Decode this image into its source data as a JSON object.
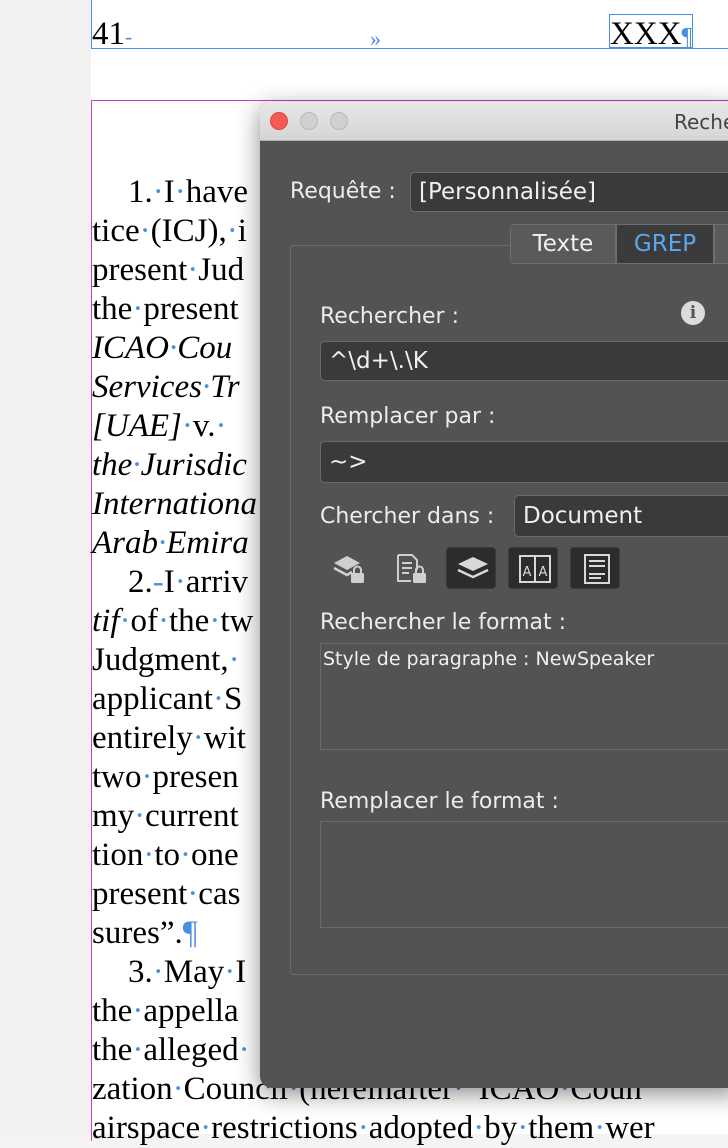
{
  "document": {
    "page_number": "41",
    "header_right": "XXX",
    "lines": [
      {
        "indent": true,
        "html": "1.<span class=\"inv\">·</span>I<span class=\"inv\">·</span>have"
      },
      {
        "indent": false,
        "html": "tice<span class=\"inv\">·</span>(ICJ),<span class=\"inv\">·</span>i"
      },
      {
        "indent": false,
        "html": "present<span class=\"inv\">·</span>Jud"
      },
      {
        "indent": false,
        "html": "the<span class=\"inv\">·</span>present"
      },
      {
        "indent": false,
        "html": "<i>ICAO<span class=\"inv\">·</span>Cou</i>"
      },
      {
        "indent": false,
        "html": "<i>Services<span class=\"inv\">·</span>Tr</i>"
      },
      {
        "indent": false,
        "html": "<i>[UAE]</i><span class=\"inv\">·</span>v.<span class=\"inv\">·</span>"
      },
      {
        "indent": false,
        "html": "<i>the<span class=\"inv\">·</span>Jurisdic</i>"
      },
      {
        "indent": false,
        "html": "<i>Internationa</i>"
      },
      {
        "indent": false,
        "html": "<i>Arab<span class=\"inv\">·</span>Emira</i>"
      },
      {
        "indent": true,
        "html": "2.<span class=\"inv\">‑</span>I<span class=\"inv\">·</span>arriv"
      },
      {
        "indent": false,
        "html": "<i>tif</i><span class=\"inv\">·</span>of<span class=\"inv\">·</span>the<span class=\"inv\">·</span>tw"
      },
      {
        "indent": false,
        "html": "Judgment,<span class=\"inv\">·</span>"
      },
      {
        "indent": false,
        "html": "applicant<span class=\"inv\">·</span>S"
      },
      {
        "indent": false,
        "html": "entirely<span class=\"inv\">·</span>wit"
      },
      {
        "indent": false,
        "html": "two<span class=\"inv\">·</span>presen"
      },
      {
        "indent": false,
        "html": "my<span class=\"inv\">·</span>current"
      },
      {
        "indent": false,
        "html": "tion<span class=\"inv\">·</span>to<span class=\"inv\">·</span>one"
      },
      {
        "indent": false,
        "html": "present<span class=\"inv\">·</span>cas"
      },
      {
        "indent": false,
        "html": "sures”.<span class=\"inv\">¶</span>"
      },
      {
        "indent": true,
        "html": "3.<span class=\"inv\">·</span>May<span class=\"inv\">·</span>I"
      },
      {
        "indent": false,
        "html": "the<span class=\"inv\">·</span>appella"
      },
      {
        "indent": false,
        "html": "the<span class=\"inv\">·</span>alleged<span class=\"inv\">·</span>"
      },
      {
        "indent": false,
        "html": "zation<span class=\"inv\">·</span>Council<span class=\"inv\">·</span>(hereinafter<span class=\"inv\">·</span>“ICAO<span class=\"inv\">·</span>Coun"
      },
      {
        "indent": false,
        "html": "airspace<span class=\"inv\">·</span>restrictions<span class=\"inv\">·</span>adopted<span class=\"inv\">·</span>by<span class=\"inv\">·</span>them<span class=\"inv\">·</span>wer"
      }
    ]
  },
  "dialog": {
    "title": "Reche",
    "query_label": "Requête :",
    "query_value": "[Personnalisée]",
    "tabs": [
      "Texte",
      "GREP",
      ""
    ],
    "active_tab": "GREP",
    "find_label": "Rechercher :",
    "find_value": "^\\d+\\.\\K",
    "replace_label": "Remplacer par :",
    "replace_value": "~>",
    "search_in_label": "Chercher dans :",
    "search_in_value": "Document",
    "find_format_label": "Rechercher le format :",
    "find_format_value": "Style de paragraphe : NewSpeaker",
    "replace_format_label": "Remplacer le format :",
    "icons": [
      "include-locked-layers-icon",
      "include-locked-stories-icon",
      "include-hidden-layers-icon",
      "include-master-pages-icon",
      "include-footnotes-icon"
    ],
    "accent_color": "#5aa8f0",
    "close_color": "#f45952"
  }
}
